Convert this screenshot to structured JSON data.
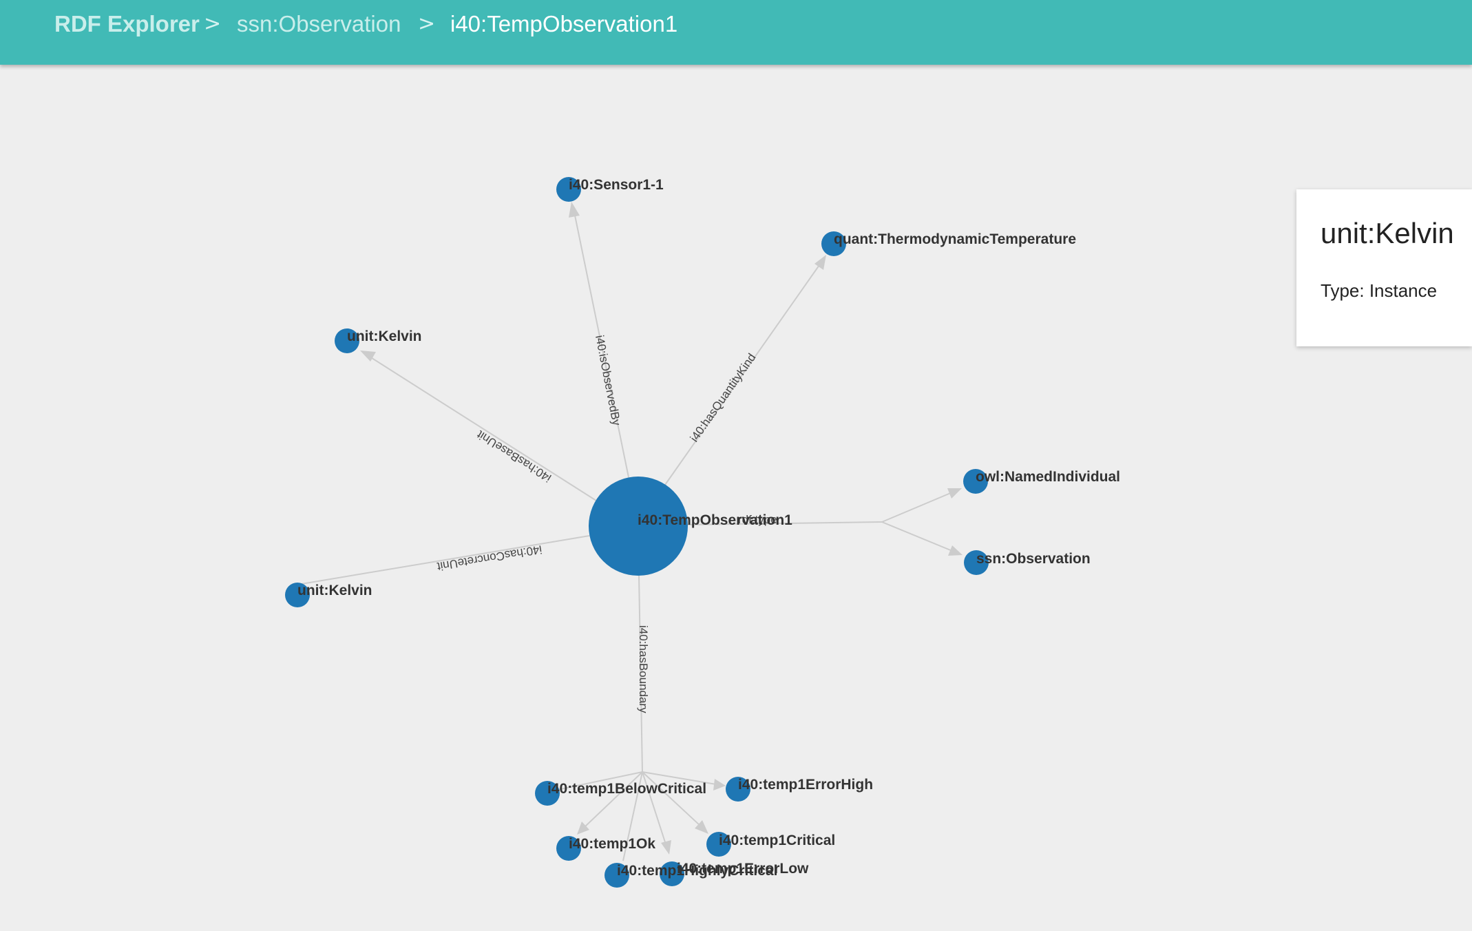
{
  "breadcrumb": {
    "app_title": "RDF Explorer",
    "separator": ">",
    "items": [
      "ssn:Observation",
      "i40:TempObservation1"
    ]
  },
  "graph": {
    "center": "i40:TempObservation1",
    "nodes": [
      "i40:Sensor1-1",
      "quant:ThermodynamicTemperature",
      "unit:Kelvin",
      "owl:NamedIndividual",
      "ssn:Observation",
      "unit:Kelvin",
      "i40:temp1BelowCritical",
      "i40:temp1ErrorHigh",
      "i40:temp1Critical",
      "i40:temp1Ok",
      "i40:temp1HighlyCritical",
      "i40:temp1ErrorLow"
    ],
    "edges": [
      "i40:isObservedBy",
      "i40:hasQuantityKind",
      "i40:hasBaseUnit",
      "rdf:type",
      "i40:hasConcreteUnit",
      "i40:hasBoundary"
    ],
    "node_color": "#1f77b4",
    "edge_color": "#cccccc"
  },
  "info_panel": {
    "title": "unit:Kelvin",
    "type_text": "Type: Instance"
  },
  "colors": {
    "header": "#41bab6",
    "background": "#eeeeee"
  }
}
